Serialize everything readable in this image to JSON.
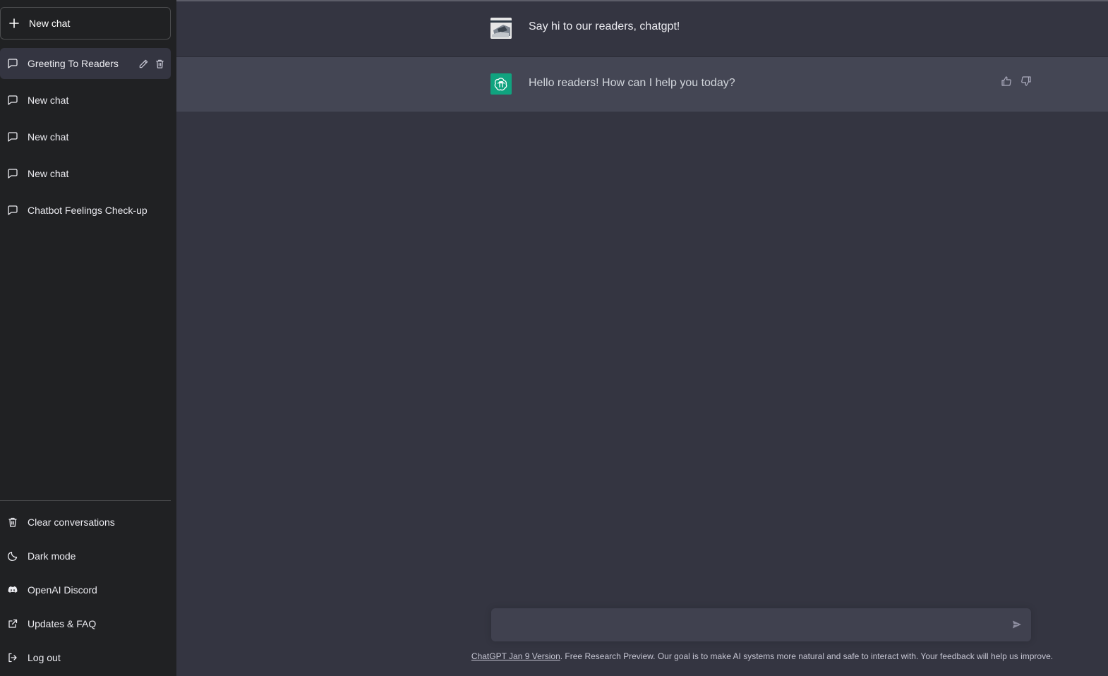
{
  "sidebar": {
    "new_chat_label": "New chat",
    "history": [
      {
        "label": "Greeting To Readers",
        "active": true
      },
      {
        "label": "New chat"
      },
      {
        "label": "New chat"
      },
      {
        "label": "New chat"
      },
      {
        "label": "Chatbot Feelings Check-up"
      }
    ],
    "bottom": [
      {
        "label": "Clear conversations",
        "icon": "trash-icon"
      },
      {
        "label": "Dark mode",
        "icon": "moon-icon"
      },
      {
        "label": "OpenAI Discord",
        "icon": "discord-icon"
      },
      {
        "label": "Updates & FAQ",
        "icon": "external-link-icon"
      },
      {
        "label": "Log out",
        "icon": "logout-icon"
      }
    ]
  },
  "conversation": {
    "user_message": "Say hi to our readers, chatgpt!",
    "bot_message": "Hello readers! How can I help you today?"
  },
  "composer": {
    "placeholder": ""
  },
  "footer": {
    "link_text": "ChatGPT Jan 9 Version",
    "text": ". Free Research Preview. Our goal is to make AI systems more natural and safe to interact with. Your feedback will help us improve."
  },
  "colors": {
    "sidebar_bg": "#202123",
    "main_bg": "#343541",
    "bot_row_bg": "#444654",
    "accent": "#10a37f"
  }
}
